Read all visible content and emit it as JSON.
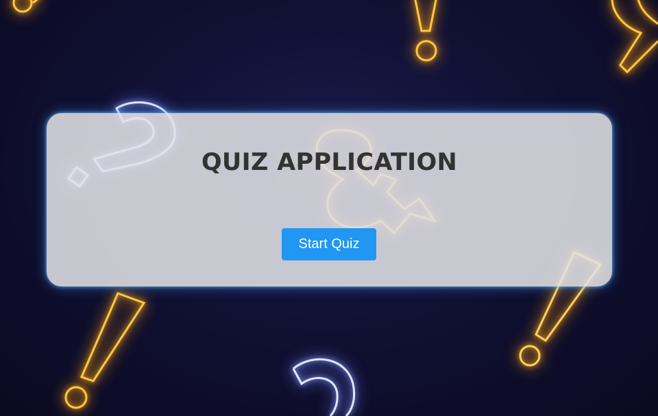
{
  "page": {
    "title": "QUIZ APPLICATION"
  },
  "actions": {
    "start_label": "Start Quiz"
  },
  "colors": {
    "button": "#2196f3",
    "title": "#333333",
    "card": "#e1e1e6",
    "background": "#0f0f30",
    "neon_gold": "#ffb020",
    "neon_white": "#dfe6ff"
  },
  "background_icons": [
    "question-mark-icon",
    "exclamation-mark-icon",
    "ampersand-icon"
  ]
}
